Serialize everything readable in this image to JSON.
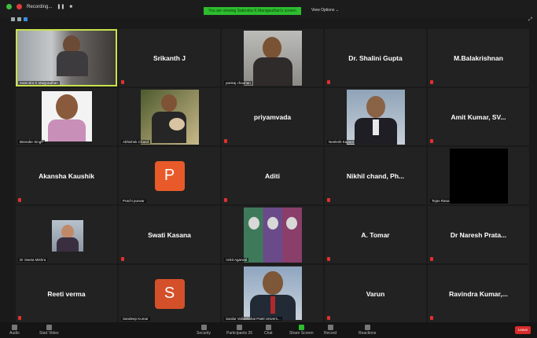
{
  "topbar": {
    "recording_label": "Recording...",
    "banner": "You are viewing Satendra K Manigauthan's screen",
    "view_options": "View Options ⌄"
  },
  "participants": [
    {
      "name": "Satendra K Maigrauthan",
      "type": "video",
      "caption": "Satendra K Maigrauthan",
      "active": true
    },
    {
      "name": "Srikanth J",
      "type": "name"
    },
    {
      "name": "pankaj chauhan",
      "type": "video",
      "caption": "pankaj chauhan"
    },
    {
      "name": "Dr. Shalini Gupta",
      "type": "name"
    },
    {
      "name": "M.Balakrishnan",
      "type": "name"
    },
    {
      "name": "Birender Singh",
      "type": "video",
      "caption": "Birender Singh"
    },
    {
      "name": "Abhishek Chand",
      "type": "video",
      "caption": "Abhishek Chand"
    },
    {
      "name": "priyamvada",
      "type": "name"
    },
    {
      "name": "Neelesh Kapoor",
      "type": "video",
      "caption": "Neelesh Kapoor"
    },
    {
      "name": "Amit Kumar, SV...",
      "type": "name"
    },
    {
      "name": "Akansha Kaushik",
      "type": "name"
    },
    {
      "name": "Prachi purwar",
      "type": "avatar",
      "letter": "P",
      "caption": "Prachi purwar"
    },
    {
      "name": "Aditi",
      "type": "name"
    },
    {
      "name": "Nikhil chand, Ph...",
      "type": "name"
    },
    {
      "name": "Tejas Rana",
      "type": "black",
      "caption": "Tejas Rana"
    },
    {
      "name": "Dr Sweta Mishra",
      "type": "video",
      "caption": "Dr Sweta Mishra"
    },
    {
      "name": "Swati Kasana",
      "type": "name"
    },
    {
      "name": "Ankit Agarwal",
      "type": "video",
      "caption": "Ankit Agarwal"
    },
    {
      "name": "A. Tomar",
      "type": "name"
    },
    {
      "name": "Dr Naresh Prata...",
      "type": "name"
    },
    {
      "name": "Reeti verma",
      "type": "name"
    },
    {
      "name": "Sandeep Kumar",
      "type": "avatar",
      "letter": "S",
      "caption": "Sandeep Kumar"
    },
    {
      "name": "Sardar Vallabhbhai Patel University",
      "type": "video",
      "caption": "Sardar Vallabhbhai Patel Univers..."
    },
    {
      "name": "Varun",
      "type": "name"
    },
    {
      "name": "Ravindra Kumar,...",
      "type": "name"
    }
  ],
  "bottombar": {
    "audio": "Audio",
    "video": "Start Video",
    "security": "Security",
    "participants": "Participants",
    "participant_count": "26",
    "chat": "Chat",
    "share": "Share Screen",
    "record": "Record",
    "reactions": "Reactions",
    "end": "Leave"
  },
  "colors": {
    "banner": "#2dbd2f",
    "avatar_p": "#e85a2a",
    "avatar_s": "#d4502a",
    "active_border": "#c8e24a",
    "end_button": "#d92b2b"
  }
}
